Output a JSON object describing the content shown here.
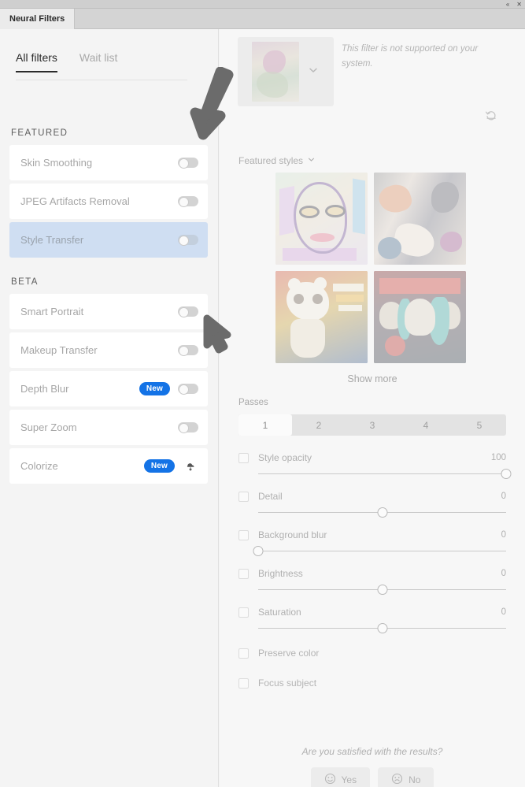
{
  "window": {
    "panel_tab": "Neural Filters",
    "collapse_icon": "double-chevron-left-icon",
    "close_icon": "close-icon"
  },
  "sidebar": {
    "tabs": [
      {
        "label": "All filters",
        "active": true
      },
      {
        "label": "Wait list",
        "active": false
      }
    ],
    "groups": [
      {
        "heading": "FEATURED",
        "items": [
          {
            "label": "Skin Smoothing",
            "toggle": "off",
            "badge": null,
            "selected": false,
            "cloud": false
          },
          {
            "label": "JPEG Artifacts Removal",
            "toggle": "off",
            "badge": null,
            "selected": false,
            "cloud": false
          },
          {
            "label": "Style Transfer",
            "toggle": "off",
            "badge": null,
            "selected": true,
            "cloud": false
          }
        ]
      },
      {
        "heading": "BETA",
        "items": [
          {
            "label": "Smart Portrait",
            "toggle": "off",
            "badge": null,
            "selected": false,
            "cloud": false
          },
          {
            "label": "Makeup Transfer",
            "toggle": "off",
            "badge": null,
            "selected": false,
            "cloud": false
          },
          {
            "label": "Depth Blur",
            "toggle": "off",
            "badge": "New",
            "selected": false,
            "cloud": false
          },
          {
            "label": "Super Zoom",
            "toggle": "off",
            "badge": null,
            "selected": false,
            "cloud": false
          },
          {
            "label": "Colorize",
            "toggle": null,
            "badge": "New",
            "selected": false,
            "cloud": true
          }
        ]
      }
    ]
  },
  "detail": {
    "notice": "This filter is not supported on your system.",
    "preview_chevron": "chevron-down-icon",
    "reset_icon": "reset-icon",
    "styles_label": "Featured styles",
    "styles_chevron": "chevron-down-icon",
    "styles": [
      {
        "name": "cubist-portrait"
      },
      {
        "name": "abstract-expressionist"
      },
      {
        "name": "day-of-the-dead-cat-poster"
      },
      {
        "name": "tattoo-skull-poster"
      }
    ],
    "show_more": "Show more",
    "passes_label": "Passes",
    "passes_options": [
      "1",
      "2",
      "3",
      "4",
      "5"
    ],
    "passes_selected": "1",
    "sliders": [
      {
        "label": "Style opacity",
        "value": "100",
        "percent": 100
      },
      {
        "label": "Detail",
        "value": "0",
        "percent": 50
      },
      {
        "label": "Background blur",
        "value": "0",
        "percent": 0
      },
      {
        "label": "Brightness",
        "value": "0",
        "percent": 50
      },
      {
        "label": "Saturation",
        "value": "0",
        "percent": 50
      }
    ],
    "checkboxes": [
      {
        "label": "Preserve color"
      },
      {
        "label": "Focus subject"
      }
    ],
    "feedback": {
      "question": "Are you satisfied with the results?",
      "yes_label": "Yes",
      "no_label": "No",
      "yes_icon": "smiley-face-icon",
      "no_icon": "frowny-face-icon"
    }
  },
  "colors": {
    "accent_blue": "#1473e6",
    "selected_row": "#cfdef2",
    "panel_bg": "#f7f7f7",
    "sidebar_bg": "#f4f4f4",
    "cursor": "#6b6b6b"
  }
}
